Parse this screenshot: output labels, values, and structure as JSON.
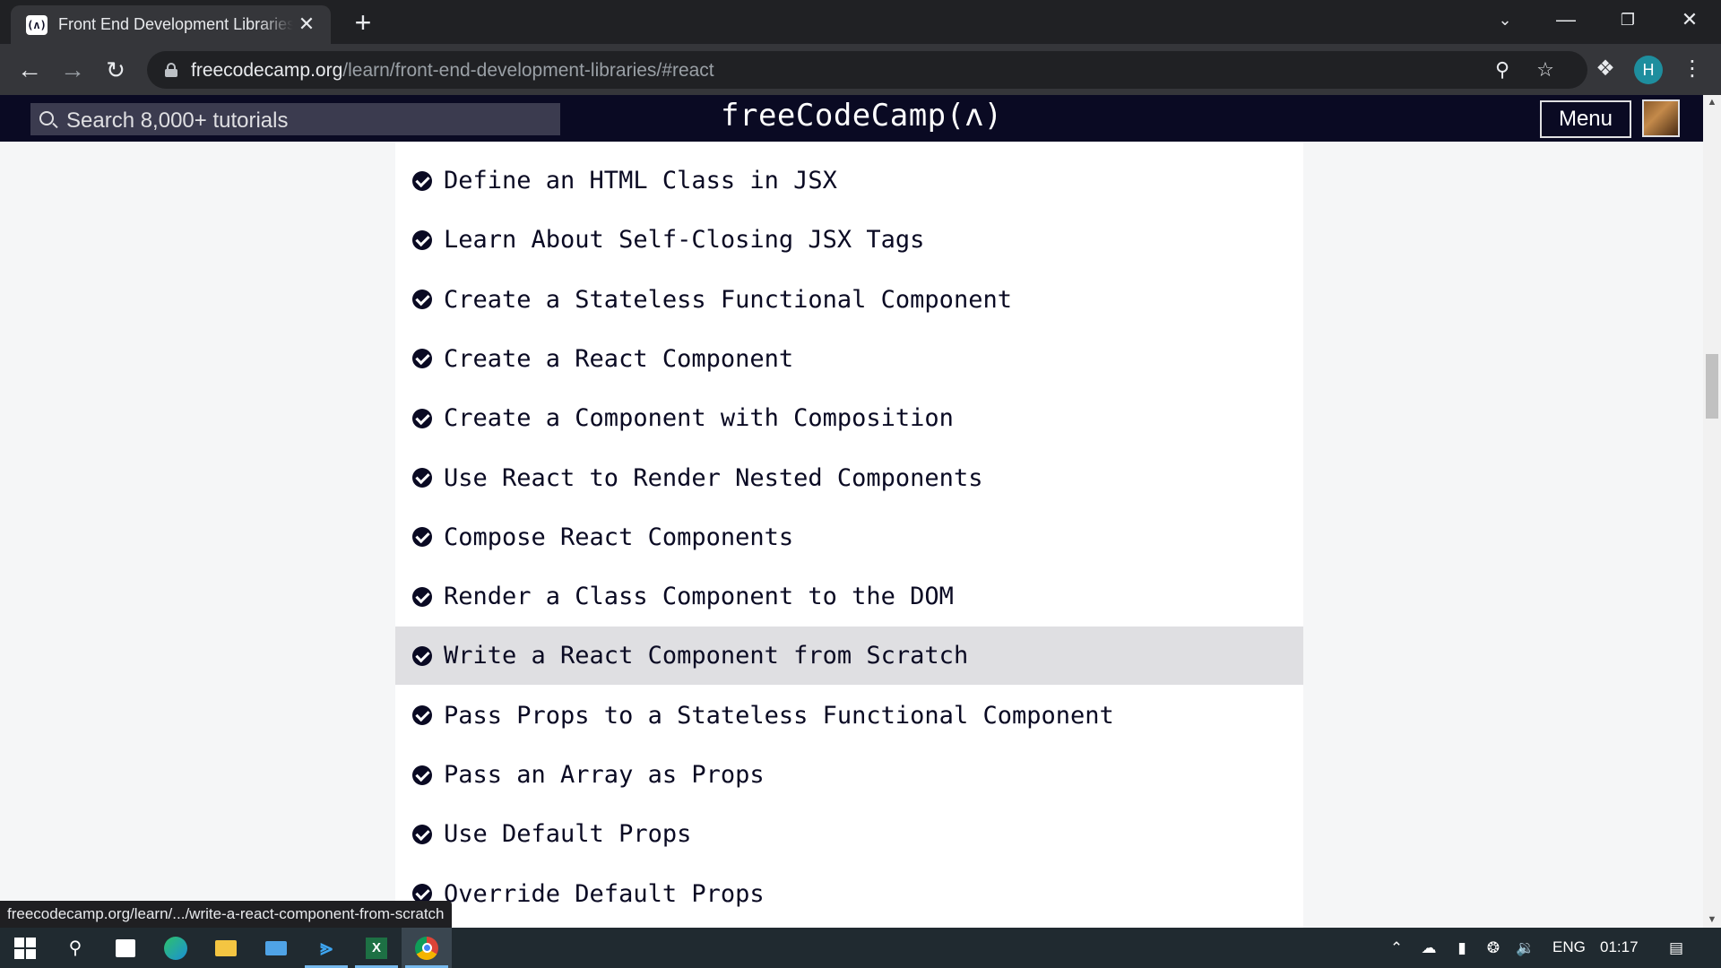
{
  "browser": {
    "tab_title": "Front End Development Libraries",
    "tab_favicon": "(ʌ)",
    "new_tab_icon": "+",
    "close_icon": "✕",
    "url_host": "freecodecamp.org",
    "url_path": "/learn/front-end-development-libraries/#react",
    "profile_initial": "H"
  },
  "site": {
    "search_placeholder": "Search 8,000+ tutorials",
    "logo": "freeCodeCamp(ʌ)",
    "menu_label": "Menu"
  },
  "lessons": [
    "Define an HTML Class in JSX",
    "Learn About Self-Closing JSX Tags",
    "Create a Stateless Functional Component",
    "Create a React Component",
    "Create a Component with Composition",
    "Use React to Render Nested Components",
    "Compose React Components",
    "Render a Class Component to the DOM",
    "Write a React Component from Scratch",
    "Pass Props to a Stateless Functional Component",
    "Pass an Array as Props",
    "Use Default Props",
    "Override Default Props"
  ],
  "highlighted_lesson": "Write a React Component from Scratch",
  "status_link": "freecodecamp.org/learn/.../write-a-react-component-from-scratch",
  "taskbar": {
    "language": "ENG",
    "time": "01:17"
  }
}
